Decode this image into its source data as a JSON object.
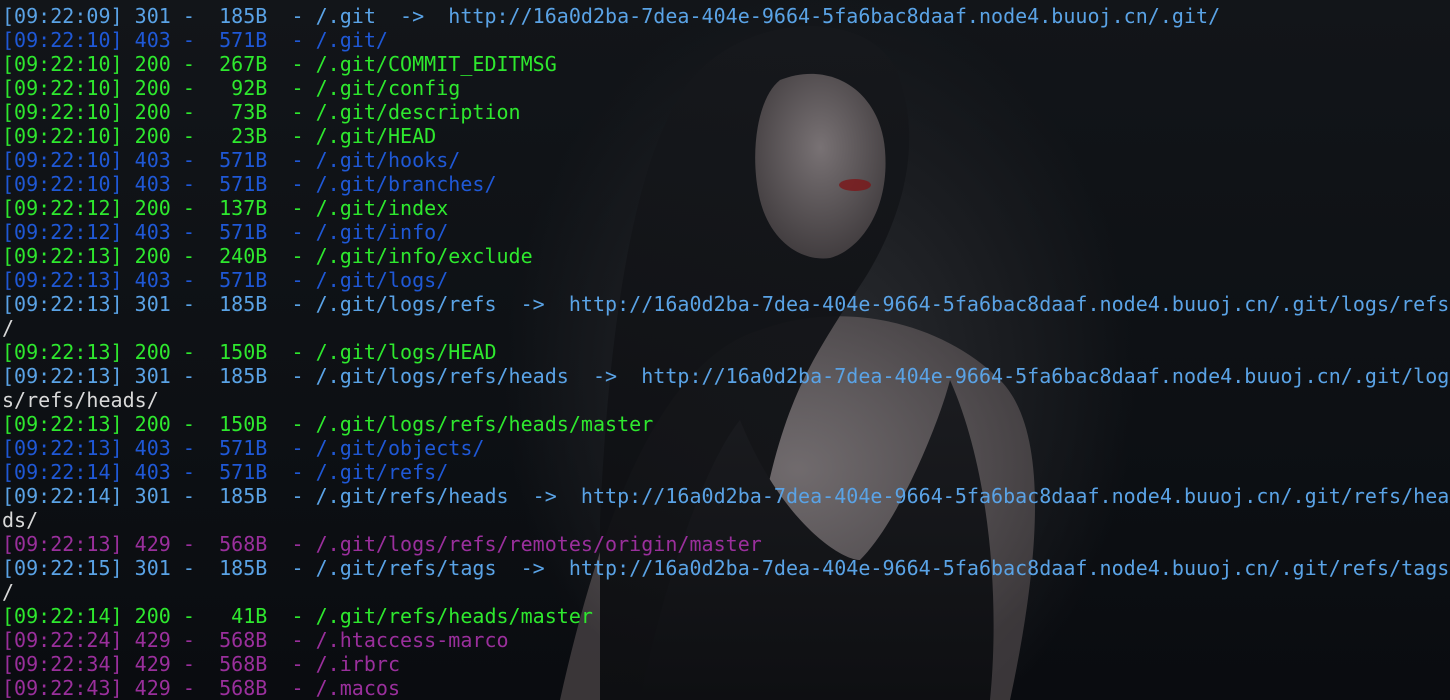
{
  "colors": {
    "status_200": "#2ee82e",
    "status_301": "#5aa3e6",
    "status_403": "#1f58d6",
    "status_429": "#9a2f9c",
    "url_text": "#d9d9d9"
  },
  "lines": [
    "[09:22:09] 301 -  185B  - /.git  ->  http://16a0d2ba-7dea-404e-9664-5fa6bac8daaf.node4.buuoj.cn/.git/",
    "[09:22:10] 403 -  571B  - /.git/",
    "[09:22:10] 200 -  267B  - /.git/COMMIT_EDITMSG",
    "[09:22:10] 200 -   92B  - /.git/config",
    "[09:22:10] 200 -   73B  - /.git/description",
    "[09:22:10] 200 -   23B  - /.git/HEAD",
    "[09:22:10] 403 -  571B  - /.git/hooks/",
    "[09:22:10] 403 -  571B  - /.git/branches/",
    "[09:22:12] 200 -  137B  - /.git/index",
    "[09:22:12] 403 -  571B  - /.git/info/",
    "[09:22:13] 200 -  240B  - /.git/info/exclude",
    "[09:22:13] 403 -  571B  - /.git/logs/",
    "[09:22:13] 301 -  185B  - /.git/logs/refs  ->  http://16a0d2ba-7dea-404e-9664-5fa6bac8daaf.node4.buuoj.cn/.git/logs/refs",
    "/",
    "[09:22:13] 200 -  150B  - /.git/logs/HEAD",
    "[09:22:13] 301 -  185B  - /.git/logs/refs/heads  ->  http://16a0d2ba-7dea-404e-9664-5fa6bac8daaf.node4.buuoj.cn/.git/log",
    "s/refs/heads/",
    "[09:22:13] 200 -  150B  - /.git/logs/refs/heads/master",
    "[09:22:13] 403 -  571B  - /.git/objects/",
    "[09:22:14] 403 -  571B  - /.git/refs/",
    "[09:22:14] 301 -  185B  - /.git/refs/heads  ->  http://16a0d2ba-7dea-404e-9664-5fa6bac8daaf.node4.buuoj.cn/.git/refs/hea",
    "ds/",
    "[09:22:13] 429 -  568B  - /.git/logs/refs/remotes/origin/master",
    "[09:22:15] 301 -  185B  - /.git/refs/tags  ->  http://16a0d2ba-7dea-404e-9664-5fa6bac8daaf.node4.buuoj.cn/.git/refs/tags",
    "/",
    "[09:22:14] 200 -   41B  - /.git/refs/heads/master",
    "[09:22:24] 429 -  568B  - /.htaccess-marco",
    "[09:22:34] 429 -  568B  - /.irbrc",
    "[09:22:43] 429 -  568B  - /.macos"
  ]
}
